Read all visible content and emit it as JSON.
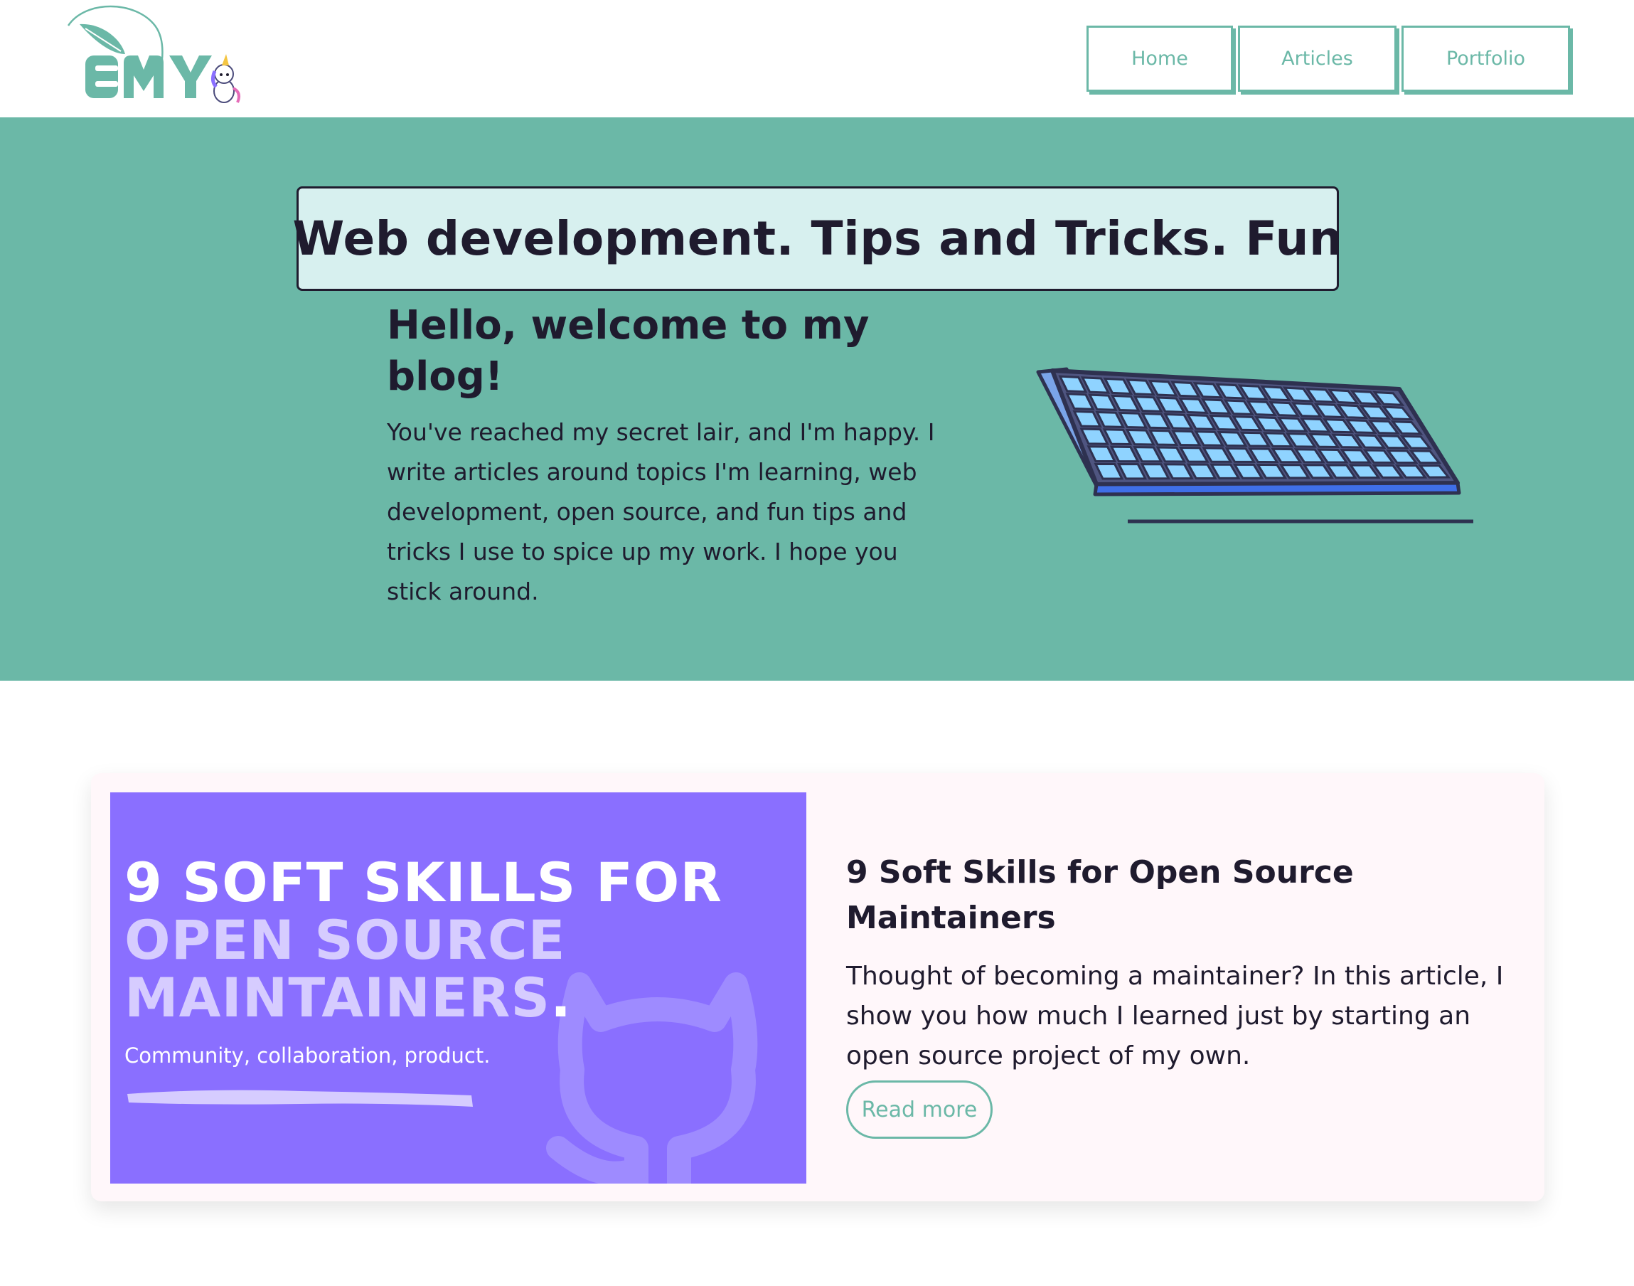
{
  "header": {
    "logo_text": "EMY",
    "nav": [
      {
        "label": "Home"
      },
      {
        "label": "Articles"
      },
      {
        "label": "Portfolio"
      }
    ]
  },
  "hero": {
    "tagline": "Web development. Tips and Tricks. Fun",
    "title": "Hello, welcome to my blog!",
    "intro": "You've reached my secret lair, and I'm happy. I write articles around topics I'm learning, web development, open source, and fun tips and tricks I use to spice up my work. I hope you stick around."
  },
  "article": {
    "cover": {
      "line1": "9 SOFT SKILLS FOR",
      "line2": "OPEN SOURCE",
      "line3": "MAINTAINERS",
      "period": ".",
      "subtitle": "Community, collaboration, product."
    },
    "title": "9 Soft Skills for Open Source Maintainers",
    "excerpt": "Thought of becoming a maintainer? In this article, I show you how much I learned just by starting an open source project of my own.",
    "read_more": "Read more"
  },
  "colors": {
    "accent": "#6bb8a7",
    "tagline_bg": "#d7f0ef",
    "cover_bg": "#8a6fff",
    "text_dark": "#1f1b2e",
    "card_bg": "#fff7fa"
  }
}
